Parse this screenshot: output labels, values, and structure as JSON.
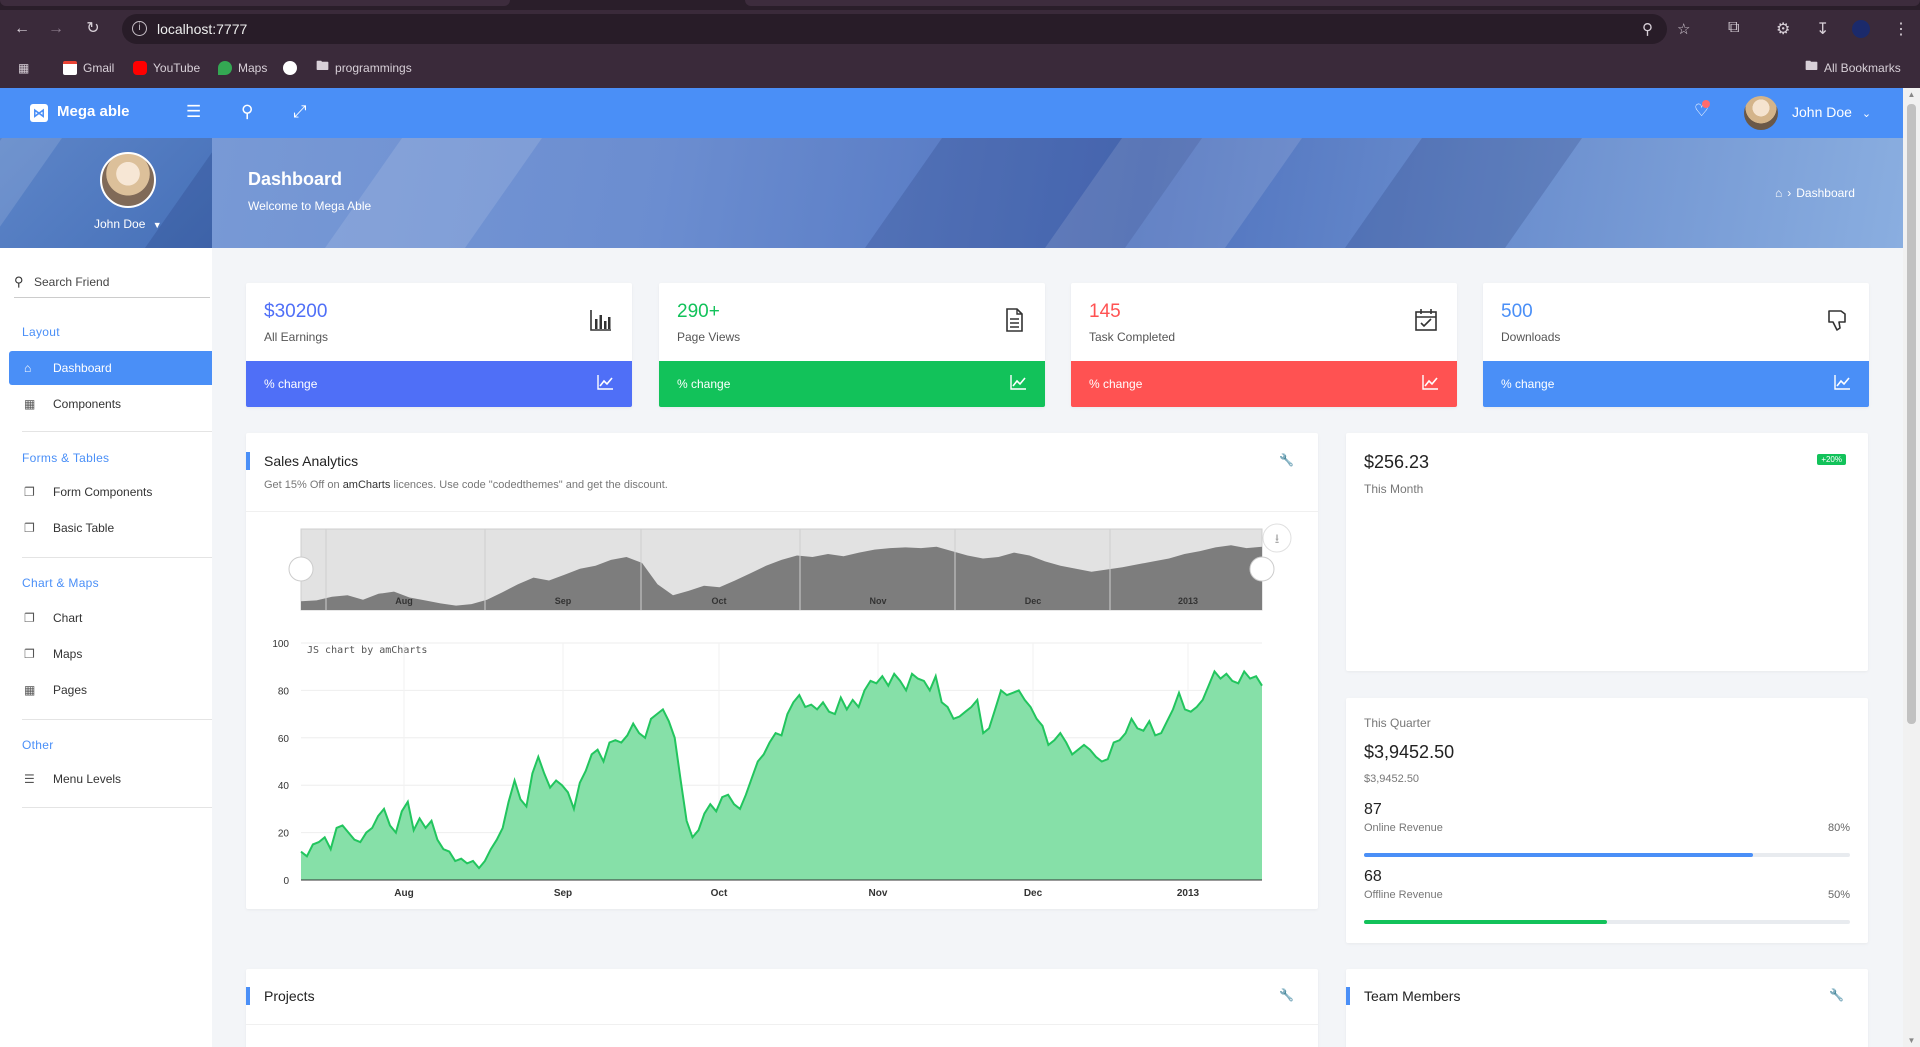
{
  "browser": {
    "url": "localhost:7777",
    "bookmarks": [
      "Gmail",
      "YouTube",
      "Maps",
      "programmings"
    ],
    "all_bookmarks": "All Bookmarks"
  },
  "app": {
    "logo": "Mega able",
    "user_name": "John Doe"
  },
  "banner": {
    "title": "Dashboard",
    "subtitle": "Welcome to Mega Able",
    "breadcrumb": "Dashboard"
  },
  "sidebar": {
    "profile_name": "John Doe",
    "search_placeholder": "Search Friend",
    "sections": [
      {
        "caption": "Layout",
        "items": [
          {
            "label": "Dashboard",
            "icon": "home-icon",
            "active": true
          },
          {
            "label": "Components",
            "icon": "grid-icon"
          }
        ]
      },
      {
        "caption": "Forms & Tables",
        "items": [
          {
            "label": "Form Components",
            "icon": "layers-icon"
          },
          {
            "label": "Basic Table",
            "icon": "layers-icon"
          }
        ]
      },
      {
        "caption": "Chart & Maps",
        "items": [
          {
            "label": "Chart",
            "icon": "layers-icon"
          },
          {
            "label": "Maps",
            "icon": "layers-icon"
          },
          {
            "label": "Pages",
            "icon": "grid-icon"
          }
        ]
      },
      {
        "caption": "Other",
        "items": [
          {
            "label": "Menu Levels",
            "icon": "directions-icon"
          }
        ]
      }
    ]
  },
  "stats": [
    {
      "value": "$30200",
      "label": "All Earnings",
      "footer": "% change",
      "color": "#4f6ff7",
      "icon": "bar-chart-icon"
    },
    {
      "value": "290+",
      "label": "Page Views",
      "footer": "% change",
      "color": "#12c25a",
      "icon": "document-icon"
    },
    {
      "value": "145",
      "label": "Task Completed",
      "footer": "% change",
      "color": "#ff5252",
      "icon": "calendar-check-icon"
    },
    {
      "value": "500",
      "label": "Downloads",
      "footer": "% change",
      "color": "#4a8ff7",
      "icon": "thumbs-down-icon"
    }
  ],
  "sales": {
    "title": "Sales Analytics",
    "promo_prefix": "Get 15% Off on ",
    "promo_brand": "amCharts",
    "promo_suffix": " licences. Use code \"codedthemes\" and get the discount.",
    "credit": "JS chart by amCharts"
  },
  "month_card": {
    "value": "$256.23",
    "label": "This Month",
    "badge": "+20%"
  },
  "quarter_card": {
    "caption": "This Quarter",
    "value": "$3,9452.50",
    "sub": "$3,9452.50",
    "online_value": "87",
    "online_label": "Online Revenue",
    "online_pct": "80%",
    "online_fraction": 0.8,
    "offline_value": "68",
    "offline_label": "Offline Revenue",
    "offline_pct": "50%",
    "offline_fraction": 0.5
  },
  "projects": {
    "title": "Projects"
  },
  "team": {
    "title": "Team Members"
  },
  "chart_data": {
    "type": "area",
    "ylim": [
      0,
      100
    ],
    "y_ticks": [
      0,
      20,
      40,
      60,
      80,
      100
    ],
    "x_ticks": [
      "Aug",
      "Sep",
      "Oct",
      "Nov",
      "Dec",
      "2013"
    ],
    "values": [
      12,
      10,
      15,
      16,
      18,
      13,
      22,
      23,
      20,
      17,
      16,
      20,
      22,
      27,
      30,
      23,
      20,
      29,
      33,
      21,
      26,
      22,
      25,
      17,
      13,
      12,
      8,
      9,
      7,
      8,
      5,
      8,
      13,
      17,
      22,
      33,
      42,
      34,
      31,
      45,
      52,
      45,
      39,
      42,
      40,
      37,
      30,
      41,
      46,
      53,
      55,
      50,
      58,
      59,
      58,
      61,
      66,
      62,
      60,
      68,
      70,
      72,
      67,
      60,
      42,
      25,
      18,
      21,
      28,
      32,
      29,
      35,
      36,
      32,
      30,
      36,
      43,
      50,
      53,
      58,
      62,
      61,
      70,
      75,
      78,
      73,
      74,
      72,
      75,
      71,
      70,
      77,
      72,
      76,
      73,
      80,
      84,
      83,
      86,
      82,
      87,
      84,
      80,
      87,
      85,
      84,
      80,
      86,
      75,
      73,
      68,
      69,
      71,
      73,
      76,
      62,
      64,
      72,
      80,
      78,
      79,
      80,
      76,
      73,
      68,
      65,
      57,
      59,
      62,
      58,
      53,
      55,
      57,
      55,
      52,
      50,
      51,
      58,
      59,
      62,
      68,
      64,
      63,
      67,
      61,
      62,
      67,
      72,
      79,
      72,
      71,
      73,
      76,
      82,
      88,
      85,
      87,
      84,
      83,
      88,
      85,
      86,
      82
    ],
    "navigator_values": [
      12,
      13,
      18,
      20,
      14,
      22,
      25,
      17,
      13,
      9,
      6,
      8,
      14,
      24,
      35,
      44,
      40,
      48,
      56,
      60,
      68,
      72,
      64,
      35,
      20,
      26,
      33,
      31,
      40,
      50,
      60,
      68,
      74,
      72,
      76,
      73,
      78,
      82,
      84,
      85,
      84,
      86,
      80,
      74,
      70,
      72,
      78,
      74,
      66,
      60,
      56,
      52,
      55,
      58,
      62,
      66,
      70,
      76,
      80,
      85,
      88,
      84,
      86
    ]
  }
}
